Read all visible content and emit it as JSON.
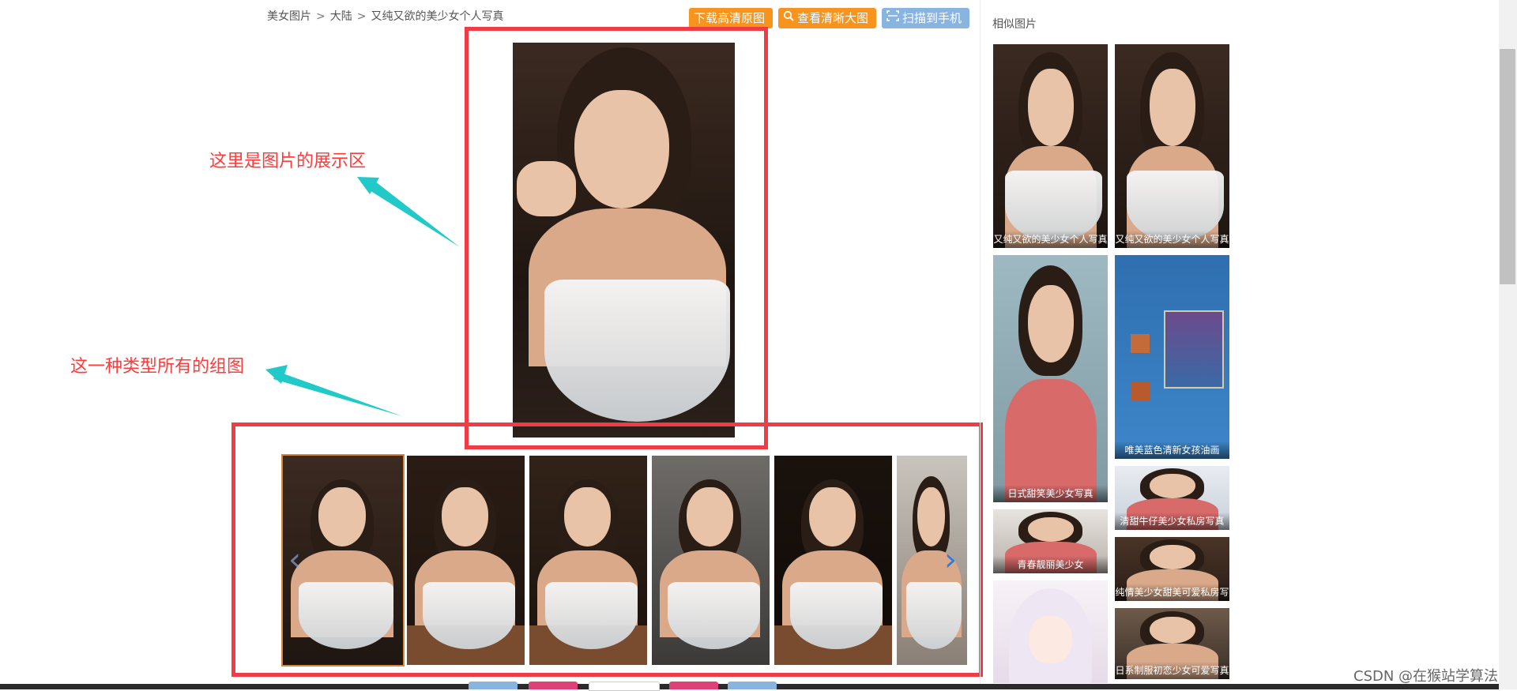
{
  "breadcrumb": [
    "美女图片",
    "大陆",
    "又纯又欲的美少女个人写真"
  ],
  "breadcrumb_sep": ">",
  "actions": {
    "download": "下载高清原图",
    "view_large": "查看清晰大图",
    "scan_phone": "扫描到手机"
  },
  "annotations": {
    "display_area": "这里是图片的展示区",
    "group_images": "这一种类型所有的组图"
  },
  "sidebar": {
    "title": "相似图片",
    "items": [
      {
        "caption": "又纯又欲的美少女个人写真"
      },
      {
        "caption": "又纯又欲的美少女个人写真"
      },
      {
        "caption": "日式甜笑美少女写真"
      },
      {
        "caption": "唯美蓝色清新女孩油画"
      },
      {
        "caption": "清甜牛仔美少女私房写真"
      },
      {
        "caption": "青春靓丽美少女"
      },
      {
        "caption": "纯情美少女甜美可爱私房写"
      },
      {
        "caption": ""
      },
      {
        "caption": "日系制服初恋少女可爱写真"
      }
    ]
  },
  "icons": {
    "thumb_prev": "chevron-left-icon",
    "thumb_next": "chevron-right-icon",
    "view_large": "search-icon",
    "scan_phone": "scan-icon"
  },
  "colors": {
    "download_btn": "#f7941d",
    "view_btn": "#f7941d",
    "scan_btn": "#8ab4e0",
    "annotation": "#f03c44",
    "arrow": "#22c9c9",
    "active_thumb": "#d9853b"
  },
  "watermark": "CSDN @在猴站学算法"
}
